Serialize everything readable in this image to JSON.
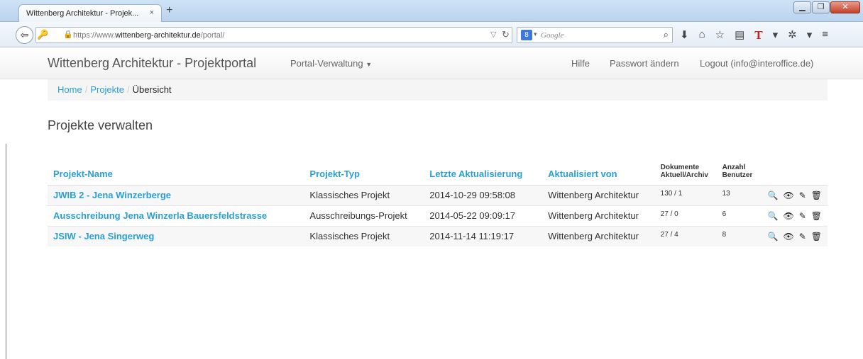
{
  "browser": {
    "tab_title": "Wittenberg Architektur - Projek...",
    "tab_close": "×",
    "new_tab": "+",
    "window_buttons": [
      "▁",
      "❐",
      "✕"
    ],
    "url_prefix": "https://www.",
    "url_domain": "wittenberg-architektur.de",
    "url_path": "/portal/",
    "search_engine_badge": "8",
    "search_placeholder": "Google"
  },
  "app": {
    "brand": "Wittenberg Architektur - Projektportal",
    "nav": {
      "admin": "Portal-Verwaltung",
      "help": "Hilfe",
      "password": "Passwort ändern",
      "logout": "Logout (info@interoffice.de)"
    },
    "breadcrumb": [
      "Home",
      "Projekte",
      "Übersicht"
    ],
    "page_title": "Projekte verwalten"
  },
  "table": {
    "headers": {
      "name": "Projekt-Name",
      "typ": "Projekt-Typ",
      "updated": "Letzte Aktualisierung",
      "by": "Aktualisiert von",
      "docs_1": "Dokumente",
      "docs_2": "Aktuell/Archiv",
      "users_1": "Anzahl",
      "users_2": "Benutzer"
    },
    "rows": [
      {
        "name": "JWIB 2 - Jena Winzerberge",
        "typ": "Klassisches Projekt",
        "updated": "2014-10-29 09:58:08",
        "by": "Wittenberg Architektur",
        "docs": "130 / 1",
        "users": "13"
      },
      {
        "name": "Ausschreibung Jena Winzerla Bauersfeldstrasse",
        "typ": "Ausschreibungs-Projekt",
        "updated": "2014-05-22 09:09:17",
        "by": "Wittenberg Architektur",
        "docs": "27 / 0",
        "users": "6"
      },
      {
        "name": "JSIW - Jena Singerweg",
        "typ": "Klassisches Projekt",
        "updated": "2014-11-14 11:19:17",
        "by": "Wittenberg Architektur",
        "docs": "27 / 4",
        "users": "8"
      }
    ]
  }
}
